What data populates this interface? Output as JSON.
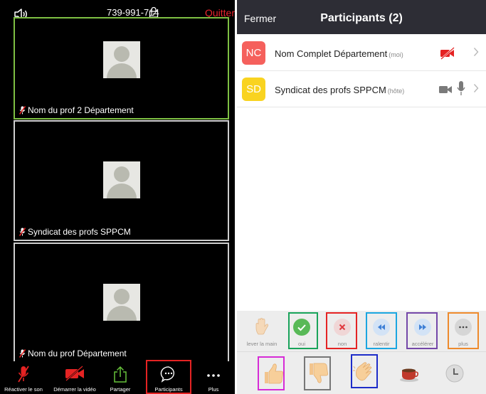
{
  "meeting": {
    "meeting_id": "739-991-714",
    "quit_label": "Quitter",
    "tiles": [
      {
        "name": "Nom du prof 2 Département"
      },
      {
        "name": "Syndicat des profs SPPCM"
      },
      {
        "name": "Nom du prof Département"
      }
    ],
    "toolbar": {
      "unmute_label": "Réactiver le son",
      "start_video_label": "Démarrer la vidéo",
      "share_label": "Partager",
      "participants_label": "Participants",
      "more_label": "Plus"
    }
  },
  "panel": {
    "close_label": "Fermer",
    "title": "Participants (2)",
    "participants": [
      {
        "initials": "NC",
        "name": "Nom Complet Département",
        "tag": "(moi)",
        "avatar_color": "#f5605c"
      },
      {
        "initials": "SD",
        "name": "Syndicat des profs SPPCM",
        "tag": "(hôte)",
        "avatar_color": "#f9d320"
      }
    ],
    "reactions": [
      {
        "label": "lever la main",
        "icon": "raise-hand-icon"
      },
      {
        "label": "oui",
        "icon": "check-icon"
      },
      {
        "label": "non",
        "icon": "x-icon"
      },
      {
        "label": "ralentir",
        "icon": "rewind-icon"
      },
      {
        "label": "accélérer",
        "icon": "fast-forward-icon"
      },
      {
        "label": "plus",
        "icon": "ellipsis-icon"
      }
    ],
    "emojis": [
      "thumbs-up-icon",
      "thumbs-down-icon",
      "clap-icon",
      "coffee-icon",
      "clock-icon"
    ]
  },
  "colors": {
    "quit": "#e8262d",
    "active_tile_border": "#7ec043",
    "muted_red": "#e52323",
    "header_bg": "#2d2d35",
    "share_green": "#67c23a"
  }
}
